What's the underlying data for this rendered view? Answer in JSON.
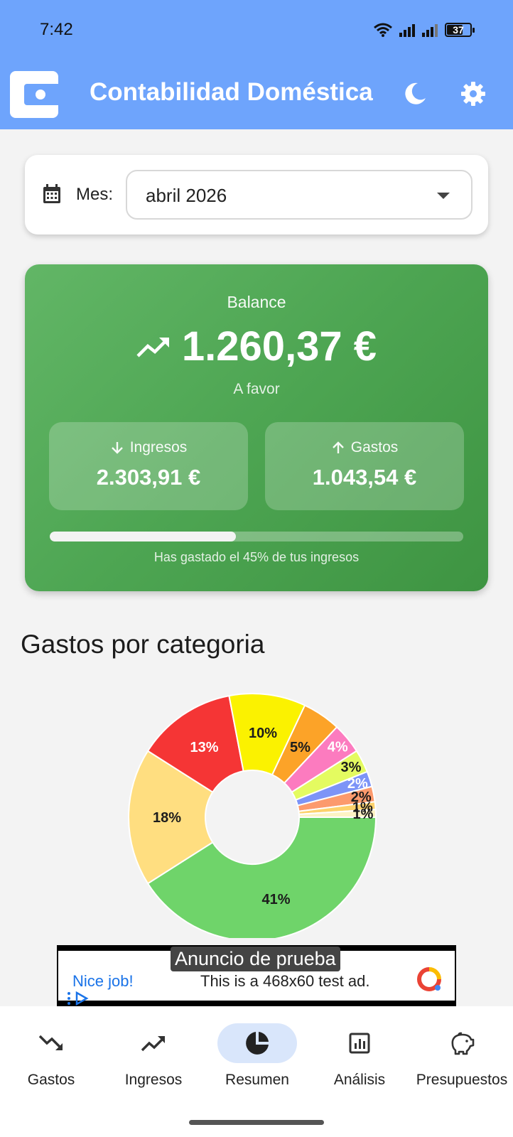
{
  "status_bar": {
    "time": "7:42",
    "battery": "37"
  },
  "app_bar": {
    "title": "Contabilidad Doméstica",
    "icons": [
      "wallet-icon",
      "dark-mode-icon",
      "settings-icon"
    ]
  },
  "month_selector": {
    "label": "Mes:",
    "value": "abril 2026"
  },
  "balance": {
    "label": "Balance",
    "amount": "1.260,37 €",
    "status": "A favor",
    "income_label": "Ingresos",
    "income_value": "2.303,91 €",
    "expenses_label": "Gastos",
    "expenses_value": "1.043,54 €",
    "spent_fraction": 0.45,
    "progress_text": "Has gastado el 45% de tus ingresos"
  },
  "section": {
    "title": "Gastos por categoria"
  },
  "chart_data": {
    "type": "pie",
    "slice_labels": [
      "41%",
      "18%",
      "13%",
      "10%",
      "5%",
      "4%",
      "3%",
      "2%",
      "2%",
      "1%",
      "1%"
    ],
    "values": [
      41,
      18,
      13,
      10,
      5,
      4,
      3,
      2,
      2,
      1,
      1
    ],
    "colors": [
      "#6fd46a",
      "#ffde80",
      "#f53535",
      "#fbf200",
      "#fca328",
      "#fc7bbf",
      "#e4fb60",
      "#7d94f7",
      "#fc9a6d",
      "#fdd26c",
      "#fdf3c4"
    ],
    "label_colors": [
      "#1c1c1c",
      "#1c1c1c",
      "#ffffff",
      "#1c1c1c",
      "#1c1c1c",
      "#ffffff",
      "#1c1c1c",
      "#ffffff",
      "#1c1c1c",
      "#1c1c1c",
      "#1c1c1c"
    ]
  },
  "ad": {
    "tag": "Anuncio de prueba",
    "headline": "Nice job!",
    "text": "This is a 468x60 test ad."
  },
  "bottom_nav": {
    "items": [
      {
        "label": "Gastos",
        "icon": "trending-down-icon"
      },
      {
        "label": "Ingresos",
        "icon": "trending-up-icon"
      },
      {
        "label": "Resumen",
        "icon": "pie-chart-icon"
      },
      {
        "label": "Análisis",
        "icon": "analytics-icon"
      },
      {
        "label": "Presupuestos",
        "icon": "piggy-bank-icon"
      }
    ],
    "active": "Resumen"
  }
}
